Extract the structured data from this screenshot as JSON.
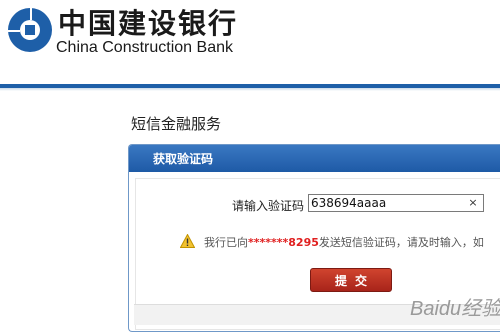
{
  "header": {
    "brand_cn": "中国建设银行",
    "brand_en": "China Construction Bank",
    "logo_icon": "ccb-coin-logo-icon",
    "brand_color": "#1e5fa8"
  },
  "section": {
    "title": "短信金融服务"
  },
  "panel": {
    "title": "获取验证码",
    "field_label": "请输入验证码",
    "code_value": "638694aaaa",
    "clear_icon": "×",
    "notice_prefix": "我行已向",
    "notice_phone": "*******8295",
    "notice_suffix": "发送短信验证码，请及时输入，如",
    "submit_label": "提交",
    "accent_color": "#1e5aa6",
    "button_color": "#b82e20"
  },
  "watermark": {
    "text": "Baidu经验"
  }
}
